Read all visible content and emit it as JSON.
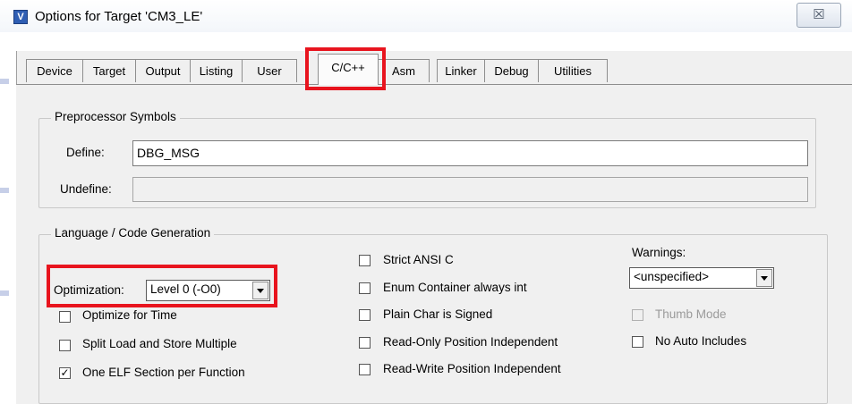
{
  "window": {
    "title": "Options for Target 'CM3_LE'",
    "close_glyph": "☒"
  },
  "tabs": [
    {
      "label": "Device"
    },
    {
      "label": "Target"
    },
    {
      "label": "Output"
    },
    {
      "label": "Listing"
    },
    {
      "label": "User"
    },
    {
      "label": "C/C++",
      "active": true
    },
    {
      "label": "Asm"
    },
    {
      "label": "Linker"
    },
    {
      "label": "Debug"
    },
    {
      "label": "Utilities"
    }
  ],
  "preprocessor": {
    "legend": "Preprocessor Symbols",
    "define_label": "Define:",
    "define_value": "DBG_MSG",
    "undefine_label": "Undefine:",
    "undefine_value": ""
  },
  "language": {
    "legend": "Language / Code Generation",
    "optimization_label": "Optimization:",
    "optimization_value": "Level 0 (-O0)",
    "left_checks": [
      {
        "label": "Optimize for Time",
        "checked": false
      },
      {
        "label": "Split Load and Store Multiple",
        "checked": false
      },
      {
        "label": "One ELF Section per Function",
        "checked": true
      }
    ],
    "mid_checks": [
      {
        "label": "Strict ANSI C",
        "checked": false
      },
      {
        "label": "Enum Container always int",
        "checked": false
      },
      {
        "label": "Plain Char is Signed",
        "checked": false
      },
      {
        "label": "Read-Only Position Independent",
        "checked": false
      },
      {
        "label": "Read-Write Position Independent",
        "checked": false
      }
    ],
    "warnings_label": "Warnings:",
    "warnings_value": "<unspecified>",
    "right_checks": [
      {
        "label": "Thumb Mode",
        "checked": false,
        "disabled": true
      },
      {
        "label": "No Auto Includes",
        "checked": false
      }
    ]
  },
  "colors": {
    "highlight": "#e8141e",
    "dialog_bg": "#f0f0f0"
  }
}
